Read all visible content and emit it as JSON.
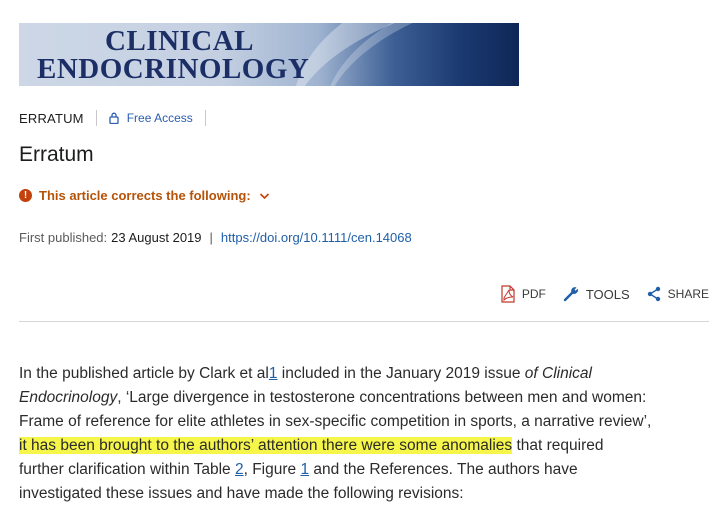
{
  "journal": {
    "name_line1": "CLINICAL",
    "name_line2": "ENDOCRINOLOGY"
  },
  "meta": {
    "article_type": "ERRATUM",
    "access_label": "Free Access"
  },
  "article": {
    "title": "Erratum",
    "corrects_label": "This article corrects the following:",
    "first_published_label": "First published:",
    "first_published_date": "23 August 2019",
    "separator": "|",
    "doi": "https://doi.org/10.1111/cen.14068"
  },
  "toolbar": {
    "pdf_label": "PDF",
    "tools_label": "TOOLS",
    "share_label": "SHARE"
  },
  "body": {
    "l1_a": "In the published article by Clark et al",
    "l1_ref": "1",
    "l1_b": " included in the January 2019 issue ",
    "l1_c": "of Clinical",
    "l2_a": "Endocrinology",
    "l2_b": ", ‘Large divergence in testosterone concentrations between men and women:",
    "l3": "Frame of reference for elite athletes in sex-specific competition in sports, a narrative review’,",
    "l4_hl": "it has been brought to the authors’ attention there were some anomalies",
    "l4_b": " that required",
    "l5_a": "further clarification within Table ",
    "l5_ref1": "2",
    "l5_b": ", Figure ",
    "l5_ref2": "1",
    "l5_c": " and the References. The authors have",
    "l6": "investigated these issues and have made the following revisions:"
  },
  "colors": {
    "link": "#1f5fa8",
    "highlight": "#f5f54a",
    "alert": "#b45309",
    "journal_text": "#1b2f66"
  },
  "icons": [
    "lock-icon",
    "alert-icon",
    "chevron-down-icon",
    "pdf-icon",
    "wrench-icon",
    "share-icon"
  ]
}
